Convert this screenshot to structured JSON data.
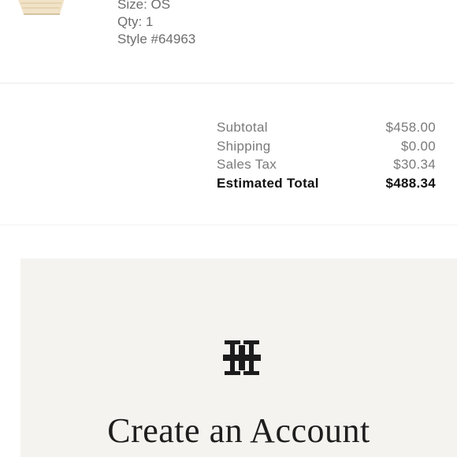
{
  "item": {
    "image_icon": "handbag-thumbnail",
    "size": "Size: OS",
    "qty": "Qty: 1",
    "style": "Style #64963"
  },
  "totals": {
    "subtotal_label": "Subtotal",
    "subtotal_value": "$458.00",
    "shipping_label": "Shipping",
    "shipping_value": "$0.00",
    "tax_label": "Sales Tax",
    "tax_value": "$30.34",
    "total_label": "Estimated Total",
    "total_value": "$488.34"
  },
  "account_card": {
    "logo_icon": "tory-burch-logo-icon",
    "title": "Create an Account",
    "background": "#f4f3ef"
  }
}
